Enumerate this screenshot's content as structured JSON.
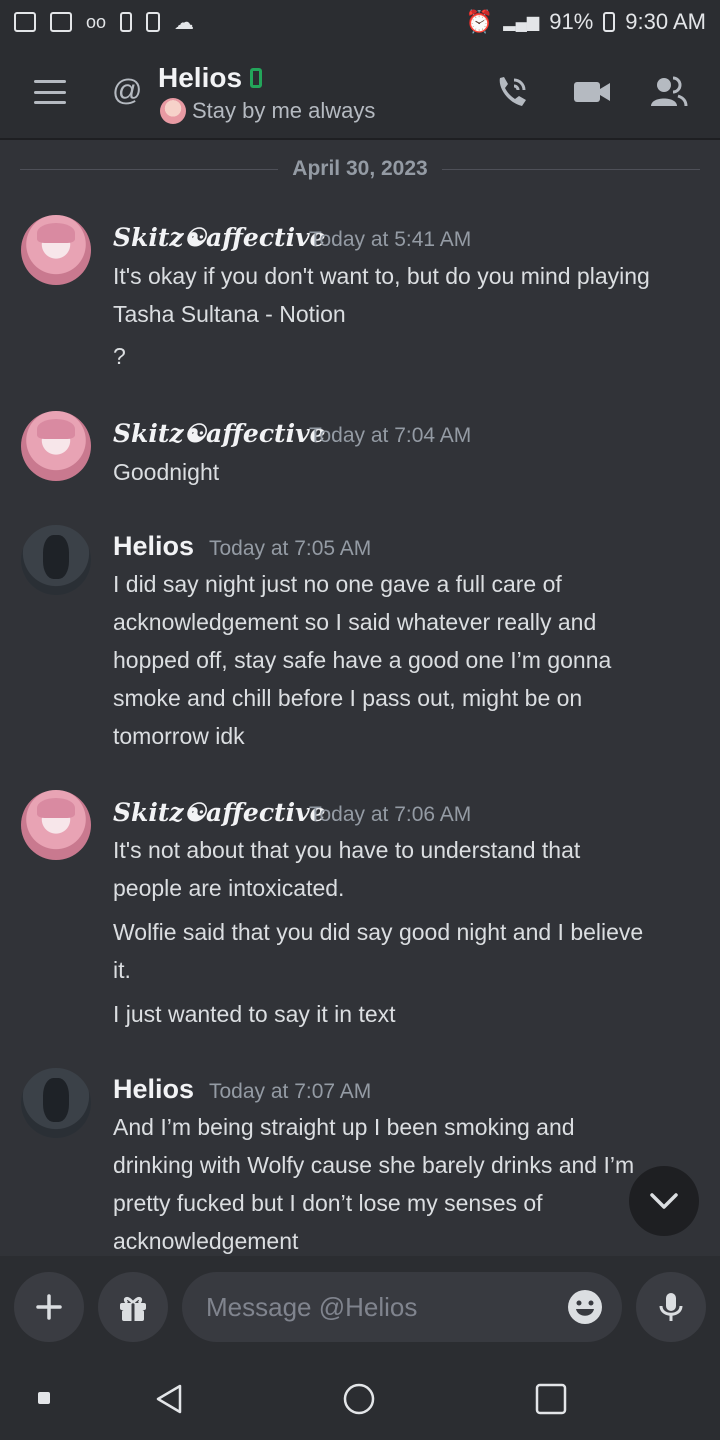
{
  "status_bar": {
    "battery": "91%",
    "time": "9:30 AM"
  },
  "header": {
    "name": "Helios",
    "status": "Stay by me always"
  },
  "date_divider": "April 30, 2023",
  "messages": [
    {
      "author": "Skitz☯affective",
      "time": "Today at 5:41 AM",
      "lines": [
        "It's okay if you don't want to, but do you mind playing",
        "Tasha Sultana - Notion",
        "?"
      ]
    },
    {
      "author": "Skitz☯affective",
      "time": "Today at 7:04 AM",
      "lines": [
        "Goodnight"
      ]
    },
    {
      "author": "Helios",
      "time": "Today at 7:05 AM",
      "lines": [
        "I did say night just no one gave a full care of",
        "acknowledgement so I said whatever really and",
        "hopped off, stay safe have a good one I’m gonna",
        "smoke and chill before I pass out, might be on",
        "tomorrow idk"
      ]
    },
    {
      "author": "Skitz☯affective",
      "time": "Today at 7:06 AM",
      "lines": [
        "It's not about that you have to understand that",
        "people are intoxicated.",
        "Wolfie said that you did say good night and I believe",
        "it.",
        "I just wanted to say it in text"
      ]
    },
    {
      "author": "Helios",
      "time": "Today at 7:07 AM",
      "lines": [
        "And I’m being straight up I been smoking and",
        "drinking with Wolfy cause she barely drinks and I’m",
        "pretty fucked but I don’t lose my senses of",
        "acknowledgement"
      ]
    }
  ],
  "composer": {
    "placeholder": "Message @Helios"
  },
  "colors": {
    "background": "#313338",
    "header_bg": "#2b2d31",
    "online_mobile": "#23a55a",
    "text_muted": "#949ba4"
  },
  "icons": {
    "header": [
      "menu-icon",
      "at-icon",
      "phone-call-icon",
      "video-call-icon",
      "members-icon"
    ],
    "composer": [
      "plus-icon",
      "gift-icon",
      "emoji-icon",
      "microphone-icon"
    ],
    "nav": [
      "recents-icon",
      "back-icon",
      "home-icon",
      "overview-icon"
    ]
  }
}
